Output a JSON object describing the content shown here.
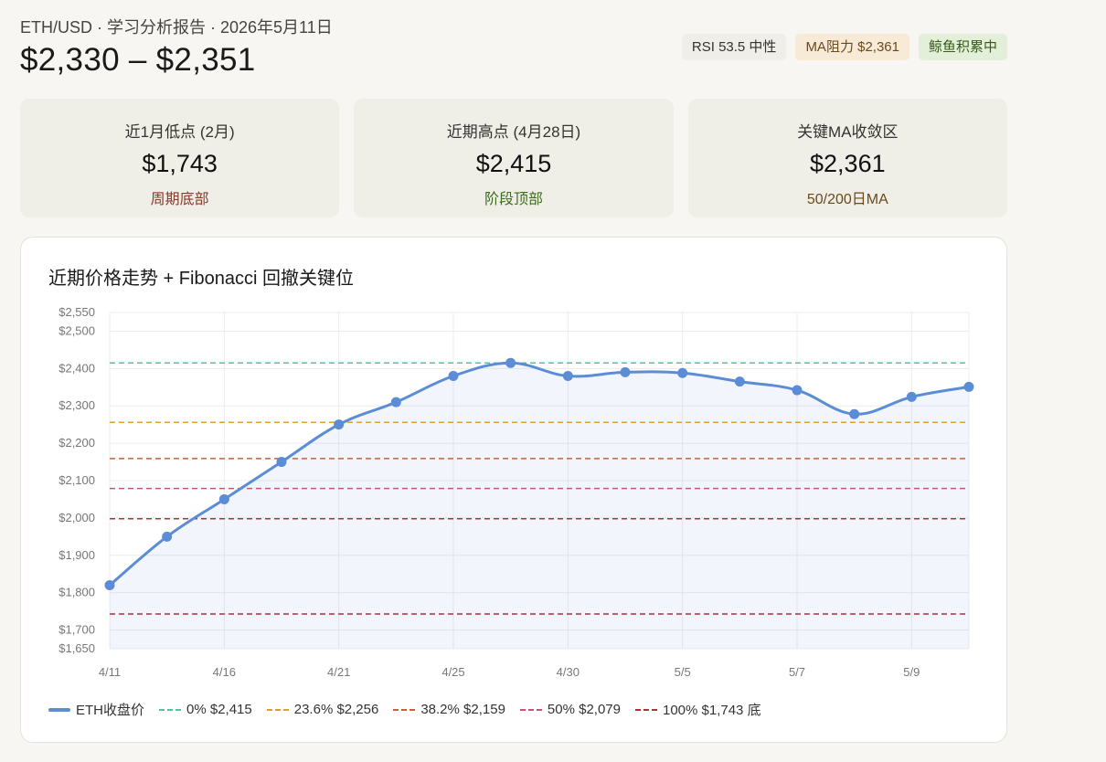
{
  "header": {
    "subtitle": "ETH/USD · 学习分析报告 · 2026年5月11日",
    "price_range": "$2,330 – $2,351"
  },
  "badges": [
    {
      "label": "RSI 53.5 中性",
      "tone": "neutral"
    },
    {
      "label": "MA阻力 $2,361",
      "tone": "warn"
    },
    {
      "label": "鲸鱼积累中",
      "tone": "good"
    }
  ],
  "cards": [
    {
      "label": "近1月低点 (2月)",
      "value": "$1,743",
      "note": "周期底部",
      "note_color": "#8a3a2a"
    },
    {
      "label": "近期高点 (4月28日)",
      "value": "$2,415",
      "note": "阶段顶部",
      "note_color": "#3f6d1e"
    },
    {
      "label": "关键MA收敛区",
      "value": "$2,361",
      "note": "50/200日MA",
      "note_color": "#6b4a1c"
    }
  ],
  "chart_data": {
    "type": "line",
    "title": "近期价格走势 + Fibonacci 回撤关键位",
    "xlabel": "",
    "ylabel": "",
    "x_tick_labels": [
      "4/11",
      "4/16",
      "4/21",
      "4/25",
      "4/30",
      "5/5",
      "5/7",
      "5/9"
    ],
    "y_tick_labels": [
      "$1,650",
      "$1,700",
      "$1,800",
      "$1,900",
      "$2,000",
      "$2,100",
      "$2,200",
      "$2,300",
      "$2,400",
      "$2,500",
      "$2,550"
    ],
    "y_ticks": [
      1650,
      1700,
      1800,
      1900,
      2000,
      2100,
      2200,
      2300,
      2400,
      2500,
      2550
    ],
    "ylim": [
      1650,
      2550
    ],
    "grid": true,
    "legend_position": "bottom-left",
    "series": [
      {
        "name": "ETH收盘价",
        "color": "#5b8dd6",
        "values": [
          1820,
          1950,
          2050,
          2150,
          2250,
          2310,
          2380,
          2415,
          2380,
          2390,
          2388,
          2365,
          2342,
          2278,
          2324,
          2351
        ]
      }
    ],
    "fibonacci_levels": [
      {
        "name": "0% $2,415",
        "value": 2415,
        "color": "#5bbf9b"
      },
      {
        "name": "23.6% $2,256",
        "value": 2256,
        "color": "#e0a030"
      },
      {
        "name": "38.2% $2,159",
        "value": 2159,
        "color": "#c8613a"
      },
      {
        "name": "50% $2,079",
        "value": 2079,
        "color": "#c4557a"
      },
      {
        "name": "100% $1,743 底",
        "value": 1743,
        "color": "#b0303a"
      }
    ],
    "extra_lines": [
      {
        "value": 1998,
        "color": "#b0303a"
      }
    ]
  }
}
